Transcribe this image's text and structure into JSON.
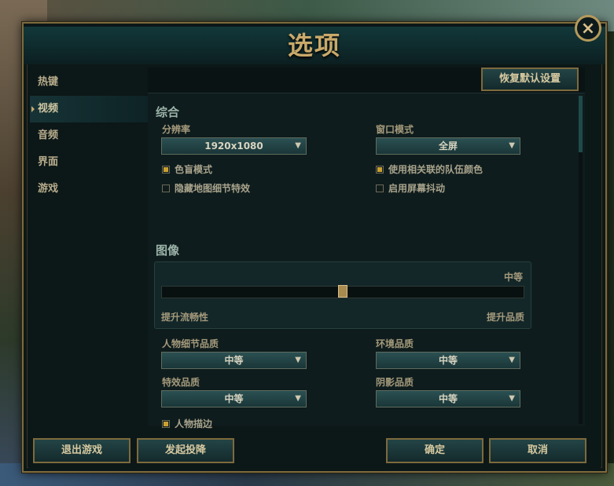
{
  "dialog": {
    "title": "选项",
    "close_icon": "×"
  },
  "sidebar": {
    "items": [
      {
        "label": "热键",
        "active": false
      },
      {
        "label": "视频",
        "active": true
      },
      {
        "label": "音频",
        "active": false
      },
      {
        "label": "界面",
        "active": false
      },
      {
        "label": "游戏",
        "active": false
      }
    ]
  },
  "panel": {
    "restore_defaults": "恢复默认设置",
    "general": {
      "heading": "综合",
      "resolution_label": "分辨率",
      "resolution_value": "1920x1080",
      "window_mode_label": "窗口模式",
      "window_mode_value": "全屏",
      "colorblind": {
        "label": "色盲模式",
        "checked": true
      },
      "team_colors": {
        "label": "使用相关联的队伍颜色",
        "checked": true
      },
      "hide_map_detail": {
        "label": "隐藏地图细节特效",
        "checked": false
      },
      "screen_shake": {
        "label": "启用屏幕抖动",
        "checked": false
      }
    },
    "graphics": {
      "heading": "图像",
      "quality_level": "中等",
      "slider_value": 0.5,
      "left_label": "提升流畅性",
      "right_label": "提升品质",
      "character_quality_label": "人物细节品质",
      "character_quality_value": "中等",
      "environment_quality_label": "环境品质",
      "environment_quality_value": "中等",
      "effects_quality_label": "特效品质",
      "effects_quality_value": "中等",
      "shadow_quality_label": "阴影品质",
      "shadow_quality_value": "中等",
      "character_outline": {
        "label": "人物描边",
        "checked": true
      }
    }
  },
  "footer": {
    "exit_game": "退出游戏",
    "surrender": "发起投降",
    "confirm": "确定",
    "cancel": "取消"
  },
  "colors": {
    "accent_gold": "#c9a96a",
    "panel_bg": "#0f1c1d",
    "checkbox_on": "#c9a030"
  }
}
